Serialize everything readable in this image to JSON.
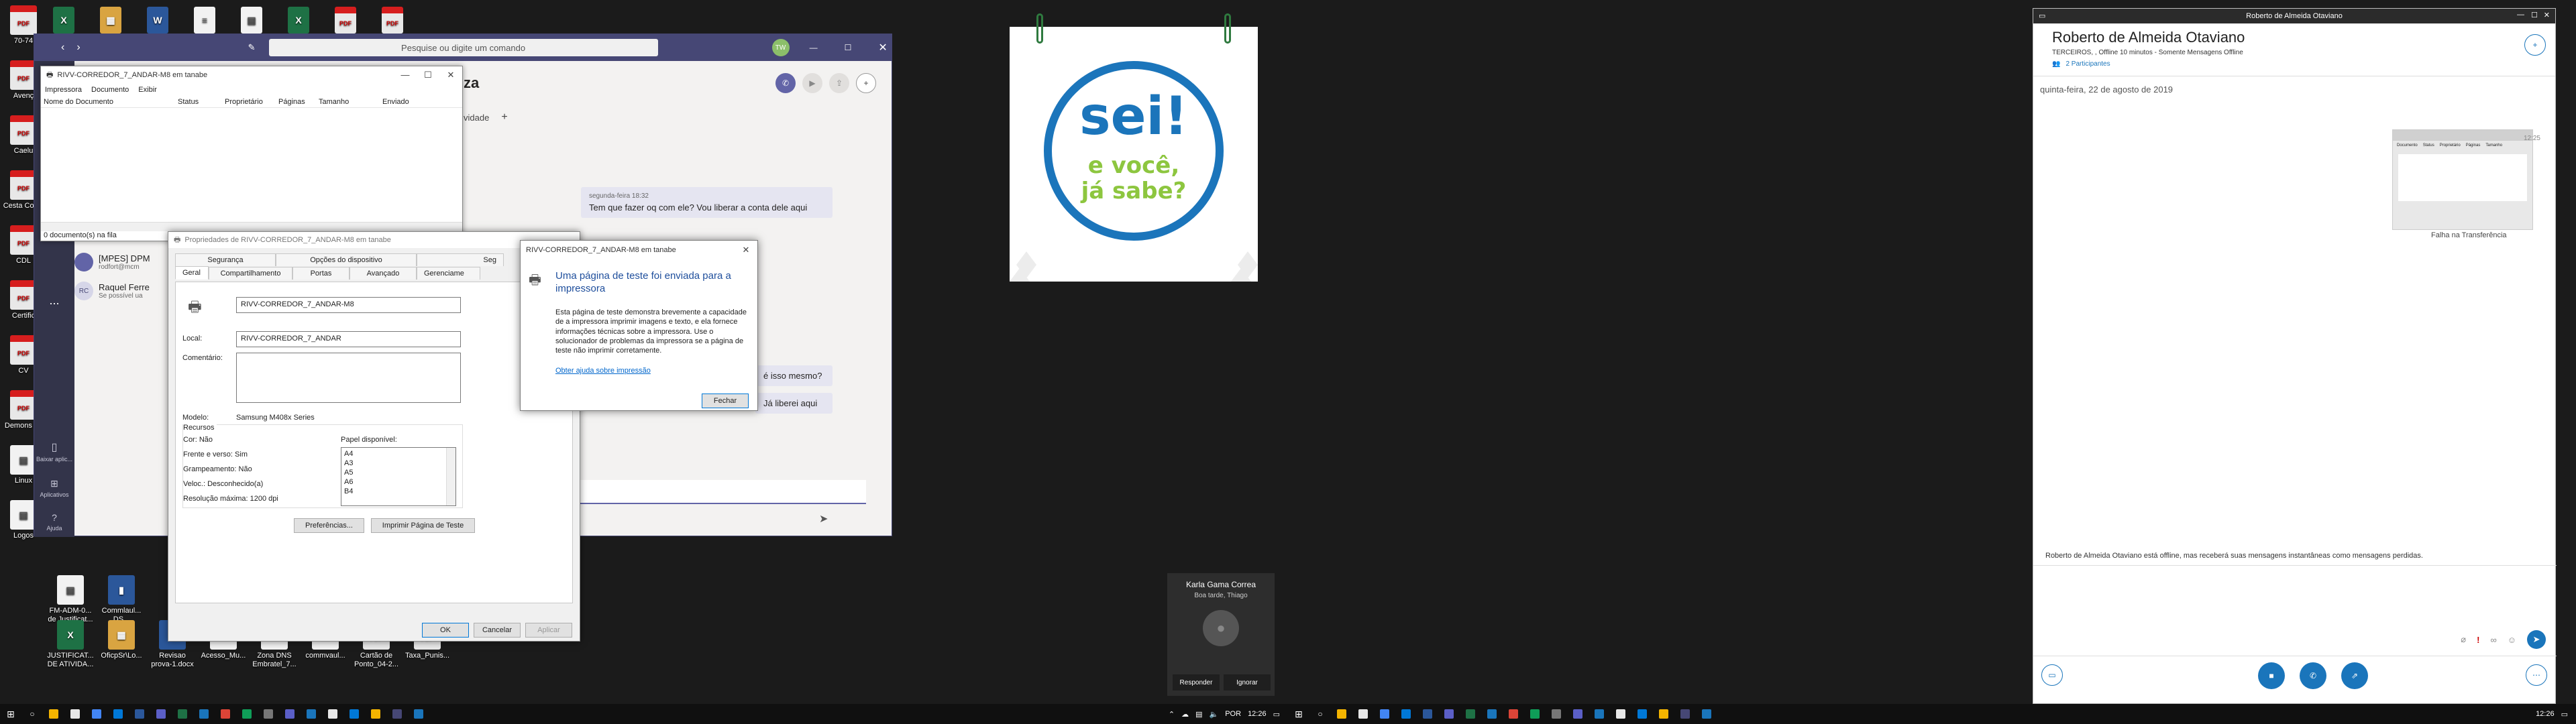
{
  "desktop_left": {
    "icons": [
      {
        "label": "70-74",
        "type": "pdf"
      },
      {
        "label": "Avenç",
        "type": "pdf"
      },
      {
        "label": "Caelu",
        "type": "pdf"
      },
      {
        "label": "Cesta Codig",
        "type": "pdf"
      },
      {
        "label": "CDL",
        "type": "pdf"
      },
      {
        "label": "Certific",
        "type": "pdf"
      },
      {
        "label": "CV",
        "type": "pdf"
      },
      {
        "label": "Demons Fit",
        "type": "pdf"
      },
      {
        "label": "Linux",
        "type": "file"
      },
      {
        "label": "Logos",
        "type": "file"
      }
    ],
    "bottom_icons": [
      {
        "label": "FM-ADM-0... de Justificat...",
        "type": "file"
      },
      {
        "label": "Commlaul... DS...",
        "type": "doc"
      },
      {
        "label": "JUSTIFICAT... DE ATIVIDA...",
        "type": "xls"
      },
      {
        "label": "OficpSr\\Lo...",
        "type": "zip"
      },
      {
        "label": "Revisao prova-1.docx",
        "type": "doc"
      },
      {
        "label": "Acesso_Mu...",
        "type": "file"
      },
      {
        "label": "Zona DNS Embratel_7...",
        "type": "file"
      },
      {
        "label": "commvaul...",
        "type": "file"
      },
      {
        "label": "Cartão de Ponto_04-2...",
        "type": "pdf"
      },
      {
        "label": "Taxa_Punis...",
        "type": "pdf"
      }
    ]
  },
  "teams": {
    "search_placeholder": "Pesquise ou digite um comando",
    "avatar_initials": "TW",
    "header_name_fragment": "za",
    "tab_fragment": "vidade",
    "add_tab": "+",
    "messages": [
      {
        "meta": "segunda-feira 18:32",
        "text": "Tem que fazer oq com ele? Vou liberar a conta dele aqui"
      },
      {
        "meta": "",
        "text": "é isso mesmo?"
      },
      {
        "meta": "",
        "text": "Já liberei aqui"
      }
    ],
    "rail": [
      {
        "label": "Baixar aplic..."
      },
      {
        "label": "Aplicativos"
      },
      {
        "label": "Ajuda"
      }
    ],
    "more_label": "...",
    "contacts": [
      {
        "name": "[MPES] DPM",
        "sub": "rodfort@mcm"
      },
      {
        "name": "Raquel Ferre",
        "sub": "Se possível ua"
      }
    ],
    "contact_initials": [
      "",
      "RC"
    ]
  },
  "queue": {
    "title": "RIVV-CORREDOR_7_ANDAR-M8 em tanabe",
    "menu": [
      "Impressora",
      "Documento",
      "Exibir"
    ],
    "columns": [
      "Nome do Documento",
      "Status",
      "Proprietário",
      "Páginas",
      "Tamanho",
      "Enviado"
    ],
    "status": "0 documento(s) na fila"
  },
  "props": {
    "title": "Propriedades de RIVV-CORREDOR_7_ANDAR-M8 em tanabe",
    "tabs_top": [
      "Segurança",
      "Opções do dispositivo",
      "Seg"
    ],
    "tabs_bottom": [
      "Geral",
      "Compartilhamento",
      "Portas",
      "Avançado",
      "Gerenciame"
    ],
    "name_value": "RIVV-CORREDOR_7_ANDAR-M8",
    "local_label": "Local:",
    "local_value": "RIVV-CORREDOR_7_ANDAR",
    "comment_label": "Comentário:",
    "model_label": "Modelo:",
    "model_value": "Samsung M408x Series",
    "features_label": "Recursos",
    "color": "Cor: Não",
    "duplex": "Frente e verso: Sim",
    "staple": "Grampeamento: Não",
    "speed": "Veloc.: Desconhecido(a)",
    "resolution": "Resolução máxima: 1200 dpi",
    "paper_label": "Papel disponível:",
    "papers": [
      "A4",
      "A3",
      "A5",
      "A6",
      "B4"
    ],
    "btn_prefs": "Preferências...",
    "btn_test": "Imprimir Página de Teste",
    "btn_ok": "OK",
    "btn_cancel": "Cancelar",
    "btn_apply": "Aplicar"
  },
  "testpage": {
    "title": "RIVV-CORREDOR_7_ANDAR-M8 em tanabe",
    "heading": "Uma página de teste foi enviada para a impressora",
    "body": "Esta página de teste demonstra brevemente a capacidade de a impressora imprimir imagens e texto, e ela fornece informações técnicas sobre a impressora. Use o solucionador de problemas da impressora se a página de teste não imprimir corretamente.",
    "link": "Obter ajuda sobre impressão",
    "close": "Fechar"
  },
  "sei": {
    "line1": "sei!",
    "line2": "e você,",
    "line3": "já sabe?",
    "colors": {
      "blue": "#1b75bb",
      "green": "#8dc63f"
    }
  },
  "toast": {
    "name": "Karla Gama Correa",
    "message": "Boa tarde, Thiago",
    "answer": "Responder",
    "ignore": "Ignorar"
  },
  "taskbar_left": {
    "lang": "POR",
    "time": "12:26"
  },
  "taskbar_right": {
    "time": "12:26"
  },
  "skype": {
    "window_title": "Roberto de Almeida Otaviano",
    "name": "Roberto de Almeida Otaviano",
    "status": "TERCEIROS, , Offline 10 minutos - Somente Mensagens Offline",
    "participants": "2 Participantes",
    "date": "quinta-feira, 22 de agosto de 2019",
    "time": "12:25",
    "transfer_fail": "Falha na Transferência",
    "offline_note": "Roberto de Almeida Otaviano está offline, mas receberá suas mensagens instantâneas como mensagens perdidas.",
    "thumb_cols": [
      "Documento",
      "Status",
      "Proprietário",
      "Páginas",
      "Tamanho"
    ]
  }
}
